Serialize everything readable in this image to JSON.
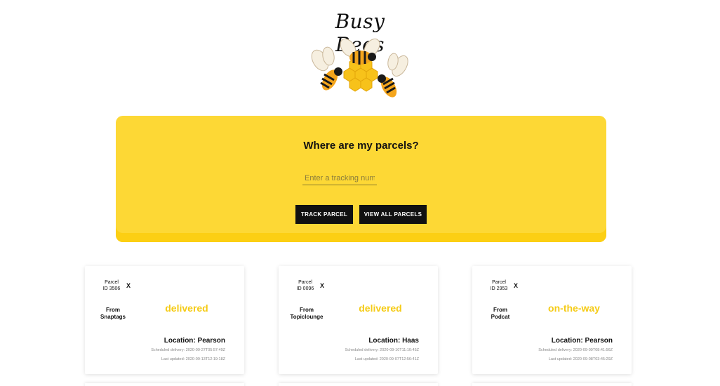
{
  "brand": {
    "logo_text": "Busy Bees"
  },
  "tracker": {
    "title": "Where are my parcels?",
    "input_placeholder": "Enter a tracking numl",
    "input_value": "",
    "track_button": "TRACK PARCEL",
    "view_all_button": "VIEW ALL PARCELS"
  },
  "colors": {
    "brand_yellow": "#fdd835",
    "status_yellow": "#f5cb16",
    "button_black": "#111111"
  },
  "parcels": [
    {
      "parcel_label": "Parcel",
      "id_label": "ID 3506",
      "close": "X",
      "from_label": "From",
      "from_name": "Snaptags",
      "status": "delivered",
      "location": "Location: Pearson",
      "scheduled": "Scheduled delivery: 2020-09-27T05:57:49Z",
      "updated": "Last updated: 2020-09-13T12:19:18Z"
    },
    {
      "parcel_label": "Parcel",
      "id_label": "ID 0096",
      "close": "X",
      "from_label": "From",
      "from_name": "Topiclounge",
      "status": "delivered",
      "location": "Location: Haas",
      "scheduled": "Scheduled delivery: 2020-09-10T11:10:45Z",
      "updated": "Last updated: 2020-09-07T12:56:41Z"
    },
    {
      "parcel_label": "Parcel",
      "id_label": "ID 2953",
      "close": "X",
      "from_label": "From",
      "from_name": "Podcat",
      "status": "on-the-way",
      "location": "Location: Pearson",
      "scheduled": "Scheduled delivery: 2020-09-09T08:41:56Z",
      "updated": "Last updated: 2020-09-08T03:45:29Z"
    }
  ]
}
